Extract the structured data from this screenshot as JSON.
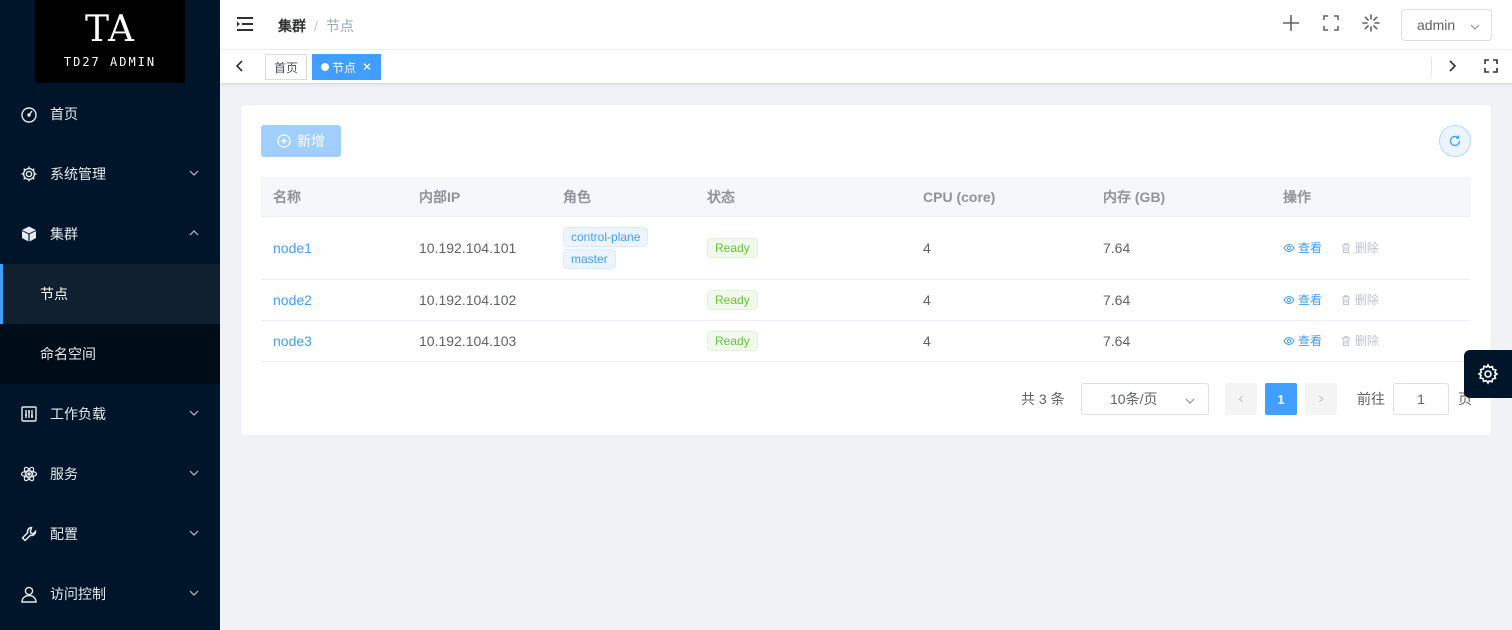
{
  "logo": {
    "big": "TA",
    "small": "TD27 ADMIN"
  },
  "sidebar": {
    "items": [
      {
        "label": "首页"
      },
      {
        "label": "系统管理"
      },
      {
        "label": "集群"
      },
      {
        "label": "工作负载"
      },
      {
        "label": "服务"
      },
      {
        "label": "配置"
      },
      {
        "label": "访问控制"
      }
    ],
    "cluster_sub": [
      {
        "label": "节点"
      },
      {
        "label": "命名空间"
      }
    ]
  },
  "header": {
    "breadcrumb": [
      "集群",
      "节点"
    ],
    "user": "admin"
  },
  "tags": [
    {
      "label": "首页"
    },
    {
      "label": "节点"
    }
  ],
  "toolbar": {
    "add_label": "新增"
  },
  "table": {
    "columns": [
      "名称",
      "内部IP",
      "角色",
      "状态",
      "CPU (core)",
      "内存 (GB)",
      "操作"
    ],
    "rows": [
      {
        "name": "node1",
        "ip": "10.192.104.101",
        "roles": [
          "control-plane",
          "master"
        ],
        "status": "Ready",
        "cpu": "4",
        "mem": "7.64",
        "view": "查看",
        "del": "删除"
      },
      {
        "name": "node2",
        "ip": "10.192.104.102",
        "roles": [],
        "status": "Ready",
        "cpu": "4",
        "mem": "7.64",
        "view": "查看",
        "del": "删除"
      },
      {
        "name": "node3",
        "ip": "10.192.104.103",
        "roles": [],
        "status": "Ready",
        "cpu": "4",
        "mem": "7.64",
        "view": "查看",
        "del": "删除"
      }
    ]
  },
  "pagination": {
    "total_text": "共 3 条",
    "page_size": "10条/页",
    "current_page": "1",
    "goto_prefix": "前往",
    "goto_value": "1",
    "goto_suffix": "页"
  },
  "colors": {
    "primary": "#409eff",
    "sidebar_bg": "#001529",
    "success": "#67c23a"
  }
}
